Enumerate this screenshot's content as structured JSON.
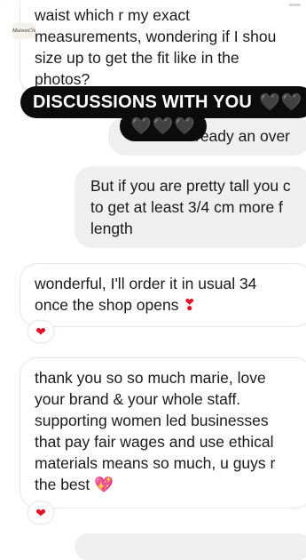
{
  "story": {
    "progress": 0.96,
    "brand": "MaisonChic",
    "close_icon": "close-icon"
  },
  "banner": {
    "title": "DISCUSSIONS WITH YOU",
    "hearts": "🖤🖤🖤",
    "title_hearts": "🖤🖤"
  },
  "messages": [
    {
      "sender": "them",
      "lines": [
        "waist which r my exact",
        "measurements, wondering if I shou",
        "size up to get the fit like in the",
        "photos?"
      ]
    },
    {
      "sender": "me",
      "lines": [
        "ready an over"
      ]
    },
    {
      "sender": "me",
      "lines": [
        "But if you are pretty tall you c",
        "to get at least 3/4 cm more f",
        "length"
      ]
    },
    {
      "sender": "them",
      "lines": [
        "wonderful, I'll order it in usual 34",
        "once the shop opens"
      ],
      "emoji": "❣",
      "reaction": "❤"
    },
    {
      "sender": "them",
      "lines": [
        "thank you so so much marie, love",
        "your brand & your whole staff.",
        "supporting women led businesses",
        "that pay fair wages and use ethical",
        "materials means so much, u guys r",
        "the best"
      ],
      "emoji": "💖",
      "reaction": "❤"
    }
  ]
}
